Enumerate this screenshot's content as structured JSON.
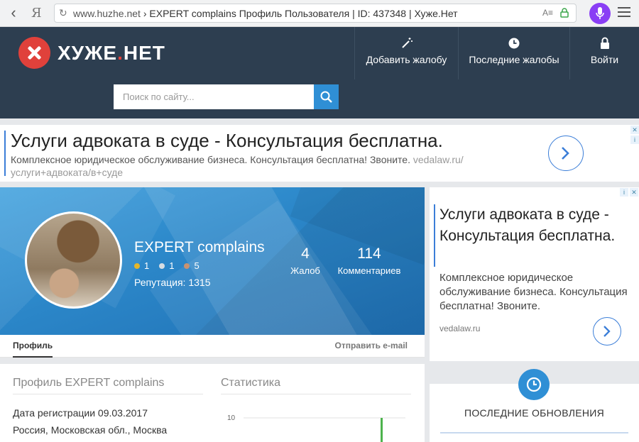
{
  "browser": {
    "url_host": "www.huzhe.net",
    "url_title": "EXPERT complains Профиль Пользователя | ID: 437348 | Хуже.Нет",
    "yandex_glyph": "Я",
    "reader_label": "A̲"
  },
  "site": {
    "logo_main": "ХУЖЕ",
    "logo_dot": ".",
    "logo_suffix": "НЕТ",
    "nav": {
      "add_complaint": "Добавить жалобу",
      "last_complaints": "Последние жалобы",
      "login": "Войти"
    },
    "search": {
      "placeholder": "Поиск по сайту..."
    }
  },
  "ad_top": {
    "title": "Услуги адвоката в суде - Консультация бесплатна.",
    "desc": "Комплексное юридическое обслуживание бизнеса. Консультация бесплатна! Звоните.",
    "url": "vedalaw.ru/ услуги+адвоката/в+суде"
  },
  "profile": {
    "name": "EXPERT complains",
    "medals": {
      "gold": "1",
      "silver": "1",
      "bronze": "5"
    },
    "reputation": "Репутация: 1315",
    "stats": {
      "complaints_count": "4",
      "complaints_label": "Жалоб",
      "comments_count": "114",
      "comments_label": "Комментариев"
    },
    "tabs": {
      "profile": "Профиль",
      "send_email": "Отправить e-mail"
    },
    "section_profile_title": "Профиль EXPERT complains",
    "section_stats_title": "Статистика",
    "reg_date": "Дата регистрации 09.03.2017",
    "location": "Россия, Московская обл., Москва"
  },
  "chart_data": {
    "type": "bar",
    "title": "",
    "xlabel": "",
    "ylabel": "",
    "y_tick_labels": [
      "10"
    ],
    "grid": true,
    "legend": "none"
  },
  "ad_side": {
    "title": "Услуги адвоката в суде - Консультация бесплатна.",
    "desc": "Комплексное юридическое обслуживание бизнеса. Консультация бесплатна! Звоните.",
    "url": "vedalaw.ru"
  },
  "updates": {
    "title": "ПОСЛЕДНИЕ ОБНОВЛЕНИЯ"
  },
  "colors": {
    "header_bg": "#2d3e50",
    "brand_red": "#e0413b",
    "accent_blue": "#2f8fd5",
    "gold": "#e6b62a",
    "silver": "#d7dde2",
    "bronze": "#c89270"
  }
}
